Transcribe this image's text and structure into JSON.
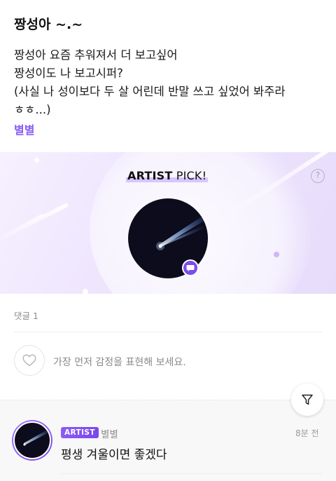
{
  "post": {
    "title": "짱성아 ~.~",
    "body_lines": [
      "짱성아 요즘 추워져서 더 보고싶어",
      "짱성이도 나 보고시퍼?",
      "(사실 나 성이보다 두 살 어린데 반말 쓰고 싶었어 봐주라",
      "ㅎㅎ...)"
    ],
    "author": "별별"
  },
  "artist_pick": {
    "title_bold": "ARTIST",
    "title_rest": " PICK!",
    "help_symbol": "?",
    "help_icon": "question-circle-icon",
    "chat_icon": "chat-bubble-icon"
  },
  "comments_section": {
    "count_label": "댓글 1",
    "emotion_prompt": "가장 먼저 감정을 표현해 보세요.",
    "emotion_icon": "heart-outline-icon",
    "filter_icon": "filter-funnel-icon"
  },
  "comments": [
    {
      "badge": "ARTIST",
      "author": "별별",
      "time": "8분 전",
      "text": "평생 겨울이면 좋겠다"
    }
  ],
  "colors": {
    "accent": "#8b5cf6",
    "avatar_bg": "#0c0c1c"
  }
}
